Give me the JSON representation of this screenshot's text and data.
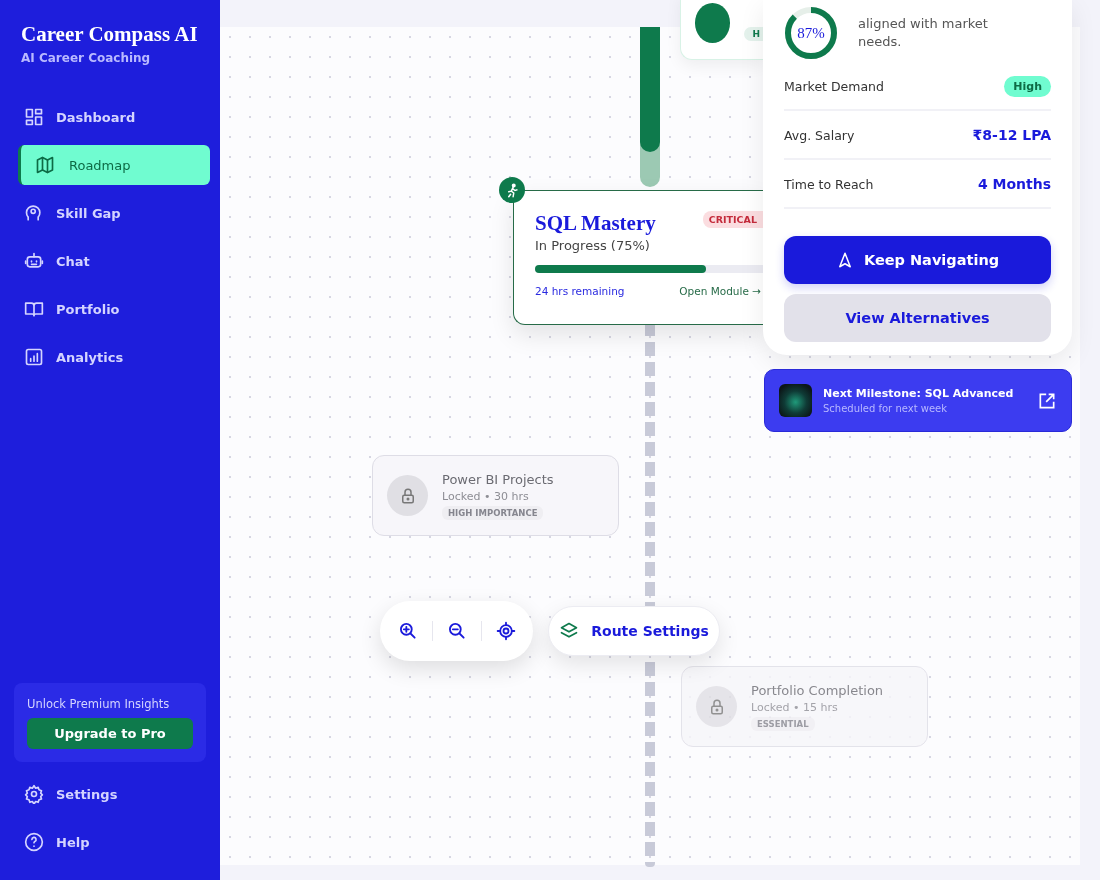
{
  "sidebar": {
    "title": "Career Compass AI",
    "subtitle": "AI Career Coaching",
    "nav": [
      {
        "label": "Dashboard",
        "selected": false
      },
      {
        "label": "Roadmap",
        "selected": true
      },
      {
        "label": "Skill Gap",
        "selected": false
      },
      {
        "label": "Chat",
        "selected": false
      },
      {
        "label": "Portfolio",
        "selected": false
      },
      {
        "label": "Analytics",
        "selected": false
      }
    ],
    "promo": {
      "text": "Unlock Premium Insights",
      "button": "Upgrade to Pro"
    },
    "footer": [
      {
        "label": "Settings"
      },
      {
        "label": "Help"
      }
    ]
  },
  "nodes": [
    {
      "kind": "partial",
      "badge": "H"
    },
    {
      "kind": "active",
      "title": "SQL Mastery",
      "status": "In Progress (75%)",
      "badge": "CRITICAL",
      "level": 0.75,
      "remaining": "24 hrs remaining",
      "link": "Open Module →"
    },
    {
      "kind": "locked",
      "title": "Power BI Projects",
      "meta": "Locked • 30 hrs",
      "badge": "HIGH IMPORTANCE"
    },
    {
      "kind": "locked",
      "title": "Portfolio Completion",
      "meta": "Locked • 15 hrs",
      "badge": "ESSENTIAL"
    }
  ],
  "map_controls": {
    "route_settings": "Route Settings"
  },
  "panel": {
    "score": "87%",
    "level": 0.87,
    "description": "aligned with market needs.",
    "stats": [
      {
        "label": "Market Demand",
        "value": "High",
        "kind": "badge"
      },
      {
        "label": "Avg. Salary",
        "value": "₹8-12 LPA",
        "kind": "text"
      },
      {
        "label": "Time to Reach",
        "value": "4 Months",
        "kind": "text"
      }
    ],
    "primary_button": "Keep Navigating",
    "secondary_button": "View Alternatives"
  },
  "milestone": {
    "title": "Next Milestone: SQL Advanced",
    "subtitle": "Scheduled for next week"
  }
}
